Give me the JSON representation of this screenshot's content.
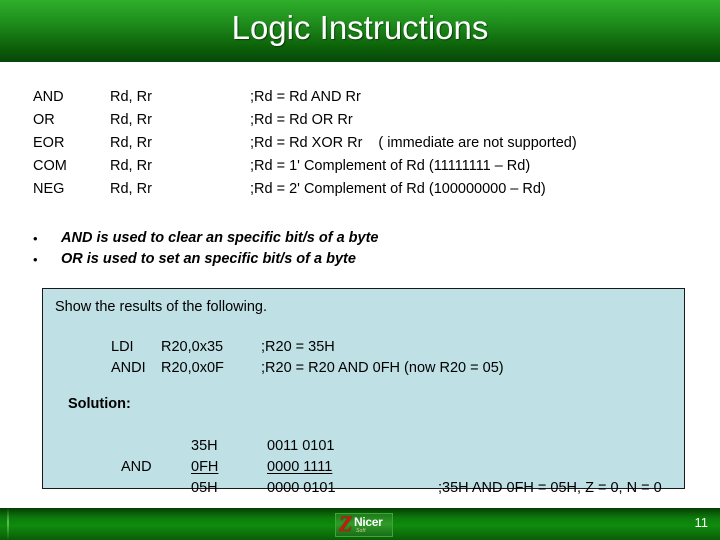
{
  "slide": {
    "title": "Logic Instructions",
    "page_number": "11",
    "accent_green_top": "#2fae2b",
    "accent_green_bottom": "#06470b",
    "example_box_fill": "#bfe0e5"
  },
  "instructions": {
    "rows": [
      {
        "mnemonic": "AND",
        "operands": "Rd, Rr",
        "comment": ";Rd = Rd AND Rr",
        "note": ""
      },
      {
        "mnemonic": "OR",
        "operands": "Rd, Rr",
        "comment": ";Rd = Rd OR Rr",
        "note": ""
      },
      {
        "mnemonic": "EOR",
        "operands": "Rd, Rr",
        "comment": ";Rd = Rd XOR Rr",
        "note": "( immediate are not supported)"
      },
      {
        "mnemonic": "COM",
        "operands": "Rd, Rr",
        "comment": ";Rd = 1' Complement of Rd (11111111 – Rd)",
        "note": ""
      },
      {
        "mnemonic": "NEG",
        "operands": "Rd, Rr",
        "comment": ";Rd = 2' Complement of Rd (100000000 – Rd)",
        "note": ""
      }
    ]
  },
  "bullets": {
    "marker": "•",
    "items": [
      "AND is used to clear an specific bit/s of a byte",
      "OR is used to set an specific bit/s of a byte"
    ]
  },
  "example": {
    "prompt": "Show the results of the following.",
    "code": [
      {
        "op": "LDI",
        "args": "R20,0x35",
        "comment": ";R20 = 35H"
      },
      {
        "op": "ANDI",
        "args": "R20,0x0F",
        "comment": ";R20 = R20 AND 0FH (now R20 = 05)"
      }
    ],
    "solution_label": "Solution:",
    "calculation": [
      {
        "operator": "",
        "hex": "35H",
        "binary": "0011 0101",
        "note": "",
        "ruled": false
      },
      {
        "operator": "AND",
        "hex": "0FH",
        "binary": "0000 1111",
        "note": "",
        "ruled": true
      },
      {
        "operator": "",
        "hex": "05H",
        "binary": "0000 0101",
        "note": ";35H AND 0FH = 05H, Z = 0, N = 0",
        "ruled": false
      }
    ]
  },
  "logo": {
    "mark": "Z",
    "name": "Nicer",
    "tagline": "Soft"
  }
}
